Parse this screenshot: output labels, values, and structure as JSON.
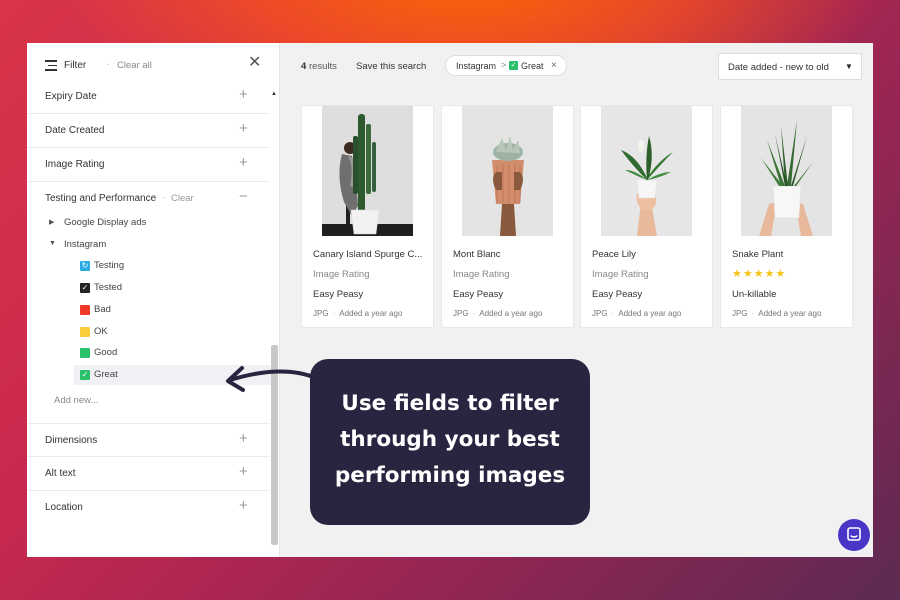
{
  "sidebar": {
    "header": {
      "title": "Filter",
      "separator": "·",
      "clear_all": "Clear all"
    },
    "sections_top": [
      {
        "label": "Expiry Date",
        "toggle": "+"
      },
      {
        "label": "Date Created",
        "toggle": "+"
      },
      {
        "label": "Image Rating",
        "toggle": "+"
      }
    ],
    "testing": {
      "label": "Testing and Performance",
      "separator": "·",
      "clear": "Clear",
      "toggle": "−"
    },
    "tree": [
      {
        "label": "Google Display ads",
        "arrow": "▶"
      },
      {
        "label": "Instagram",
        "arrow": "▼"
      }
    ],
    "options": [
      {
        "label": "Testing",
        "color": "#29abe2",
        "glyph": "↻"
      },
      {
        "label": "Tested",
        "color": "#222222",
        "glyph": "✓"
      },
      {
        "label": "Bad",
        "color": "#f0392b",
        "glyph": ""
      },
      {
        "label": "OK",
        "color": "#f9cc39",
        "glyph": ""
      },
      {
        "label": "Good",
        "color": "#2bc06a",
        "glyph": ""
      },
      {
        "label": "Great",
        "color": "#2bc06a",
        "glyph": "✓",
        "selected": true
      }
    ],
    "add_new": "Add new...",
    "sections_bottom": [
      {
        "label": "Dimensions",
        "toggle": "+"
      },
      {
        "label": "Alt text",
        "toggle": "+"
      },
      {
        "label": "Location",
        "toggle": "+"
      }
    ]
  },
  "topbar": {
    "results_count": "4",
    "results_label": "results",
    "save_search": "Save this search",
    "chip": {
      "part1": "Instagram",
      "sep": ">",
      "part2": "Great",
      "remove": "×"
    },
    "sort": {
      "label": "Date added - new to old",
      "arrow": "▼"
    }
  },
  "cards": [
    {
      "name": "Canary Island Spurge C...",
      "rating_label": "Image Rating",
      "tag": "Easy Peasy",
      "format": "JPG",
      "added": "Added a year ago"
    },
    {
      "name": "Mont Blanc",
      "rating_label": "Image Rating",
      "tag": "Easy Peasy",
      "format": "JPG",
      "added": "Added a year ago"
    },
    {
      "name": "Peace Lily",
      "rating_label": "Image Rating",
      "tag": "Easy Peasy",
      "format": "JPG",
      "added": "Added a year ago"
    },
    {
      "name": "Snake Plant",
      "stars": "★★★★★",
      "rating": 5,
      "tag": "Un-killable",
      "format": "JPG",
      "added": "Added a year ago"
    }
  ],
  "callout": {
    "line1": "Use fields to filter",
    "line2": "through your best",
    "line3": "performing images"
  },
  "colors": {
    "callout_bg": "#2b2440",
    "chat_bg": "#4a36c6",
    "great": "#2bc06a"
  }
}
